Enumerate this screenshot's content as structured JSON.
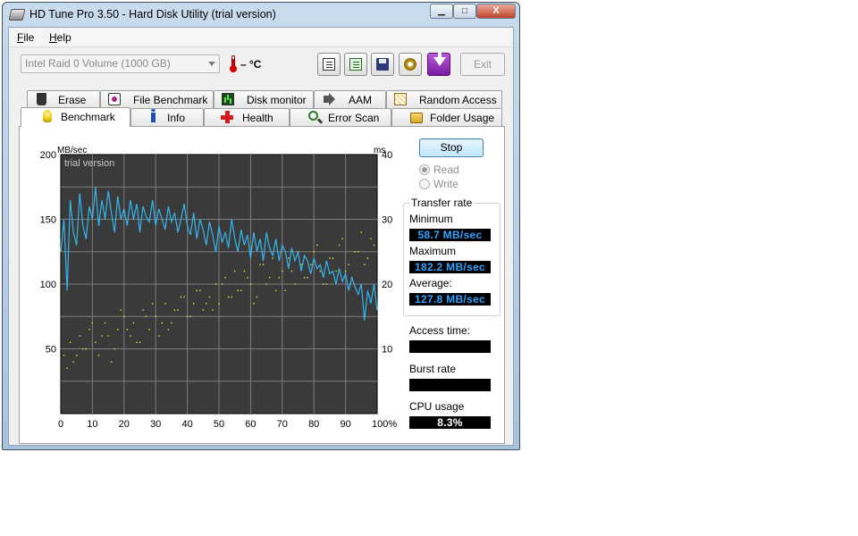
{
  "window": {
    "title": "HD Tune Pro 3.50 - Hard Disk Utility (trial version)",
    "controls": {
      "minimize": "▁",
      "maximize": "□",
      "close": "X"
    }
  },
  "menu": [
    {
      "label": "File",
      "accel": "F",
      "rest": "ile"
    },
    {
      "label": "Help",
      "accel": "H",
      "rest": "elp"
    }
  ],
  "toolbar": {
    "drive": "Intel   Raid 0 Volume (1000 GB)",
    "temperature": "– °C",
    "exit_label": "Exit"
  },
  "tabs_top": [
    "Erase",
    "File Benchmark",
    "Disk monitor",
    "AAM",
    "Random Access"
  ],
  "tabs_bottom": [
    "Benchmark",
    "Info",
    "Health",
    "Error Scan",
    "Folder Usage"
  ],
  "active_tab": "Benchmark",
  "benchmark": {
    "stop_label": "Stop",
    "read_label": "Read",
    "write_label": "Write",
    "selected_mode": "Read",
    "transfer_rate_title": "Transfer rate",
    "minimum_label": "Minimum",
    "minimum_value": "58.7 MB/sec",
    "maximum_label": "Maximum",
    "maximum_value": "182.2 MB/sec",
    "average_label": "Average:",
    "average_value": "127.8 MB/sec",
    "access_time_label": "Access time:",
    "access_time_value": "",
    "burst_rate_label": "Burst rate",
    "burst_rate_value": "",
    "cpu_usage_label": "CPU usage",
    "cpu_usage_value": "8.3%"
  },
  "chart_data": {
    "type": "line",
    "watermark": "trial version",
    "y_left_unit": "MB/sec",
    "y_right_unit": "ms",
    "ylim": [
      0,
      200
    ],
    "y_right_lim": [
      0,
      40
    ],
    "xlim": [
      0,
      100
    ],
    "x_ticks": [
      "0",
      "10",
      "20",
      "30",
      "40",
      "50",
      "60",
      "70",
      "80",
      "90",
      "100%"
    ],
    "y_left_ticks": [
      "200",
      "150",
      "100",
      "50"
    ],
    "y_right_ticks": [
      "40",
      "30",
      "20",
      "10"
    ],
    "grid": true,
    "colors": {
      "background": "#3a3a3a",
      "grid": "#7c7c7c",
      "transfer": "#33b6ef",
      "access": "#e8e83a"
    },
    "series": [
      {
        "kind": "transfer",
        "x": [
          0,
          1,
          2,
          3,
          4,
          5,
          6,
          7,
          8,
          9,
          10,
          11,
          12,
          13,
          14,
          15,
          16,
          17,
          18,
          19,
          20,
          21,
          22,
          23,
          24,
          25,
          26,
          27,
          28,
          29,
          30,
          31,
          32,
          33,
          34,
          35,
          36,
          37,
          38,
          39,
          40,
          41,
          42,
          43,
          44,
          45,
          46,
          47,
          48,
          49,
          50,
          51,
          52,
          53,
          54,
          55,
          56,
          57,
          58,
          59,
          60,
          61,
          62,
          63,
          64,
          65,
          66,
          67,
          68,
          69,
          70,
          71,
          72,
          73,
          74,
          75,
          76,
          77,
          78,
          79,
          80,
          81,
          82,
          83,
          84,
          85,
          86,
          87,
          88,
          89,
          90,
          91,
          92,
          93,
          94,
          95,
          96,
          97,
          98,
          99,
          100
        ],
        "y": [
          125,
          150,
          95,
          165,
          140,
          130,
          170,
          145,
          135,
          160,
          150,
          175,
          145,
          165,
          150,
          172,
          155,
          140,
          168,
          150,
          158,
          145,
          165,
          150,
          162,
          140,
          160,
          152,
          148,
          165,
          145,
          158,
          150,
          142,
          160,
          148,
          155,
          140,
          150,
          162,
          145,
          138,
          155,
          135,
          150,
          142,
          130,
          148,
          138,
          125,
          145,
          132,
          140,
          128,
          150,
          135,
          125,
          142,
          130,
          138,
          120,
          140,
          125,
          135,
          118,
          140,
          128,
          122,
          135,
          118,
          130,
          125,
          112,
          128,
          118,
          125,
          110,
          122,
          118,
          108,
          120,
          112,
          115,
          105,
          118,
          108,
          110,
          100,
          112,
          102,
          108,
          95,
          105,
          98,
          92,
          100,
          72,
          95,
          85,
          100,
          80
        ]
      },
      {
        "kind": "access",
        "x": [
          1,
          3,
          4,
          6,
          7,
          9,
          11,
          12,
          14,
          15,
          17,
          18,
          20,
          22,
          23,
          25,
          26,
          28,
          30,
          31,
          33,
          35,
          36,
          38,
          40,
          42,
          43,
          45,
          47,
          49,
          50,
          52,
          54,
          56,
          58,
          60,
          62,
          64,
          66,
          68,
          70,
          72,
          74,
          76,
          78,
          80,
          82,
          84,
          86,
          88,
          90,
          92,
          94,
          96,
          98,
          2,
          5,
          8,
          10,
          13,
          16,
          19,
          21,
          24,
          27,
          29,
          32,
          34,
          37,
          39,
          41,
          44,
          46,
          48,
          51,
          53,
          55,
          57,
          59,
          61,
          63,
          65,
          67,
          69,
          71,
          73,
          75,
          77,
          79,
          81,
          83,
          85,
          87,
          89,
          91,
          93,
          95,
          97,
          99
        ],
        "y": [
          9,
          11,
          8,
          12,
          10,
          13,
          11,
          9,
          14,
          12,
          10,
          13,
          15,
          12,
          14,
          11,
          16,
          13,
          15,
          12,
          17,
          14,
          16,
          18,
          15,
          17,
          19,
          16,
          18,
          20,
          17,
          21,
          18,
          19,
          22,
          20,
          18,
          23,
          21,
          19,
          22,
          24,
          20,
          23,
          21,
          25,
          22,
          20,
          24,
          26,
          22,
          21,
          25,
          23,
          27,
          7,
          9,
          10,
          14,
          12,
          8,
          16,
          13,
          11,
          15,
          17,
          14,
          13,
          16,
          18,
          15,
          19,
          17,
          16,
          20,
          18,
          22,
          19,
          21,
          17,
          23,
          20,
          24,
          21,
          19,
          22,
          25,
          21,
          23,
          26,
          20,
          24,
          22,
          27,
          23,
          25,
          28,
          24,
          26
        ]
      }
    ]
  }
}
